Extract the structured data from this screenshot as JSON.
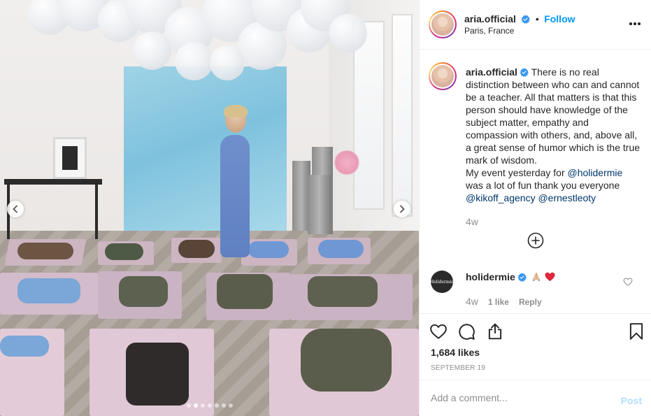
{
  "post": {
    "username": "aria.official",
    "follow_label": "Follow",
    "separator": "•",
    "location": "Paris, France",
    "image_alt": "Yoga class photo",
    "carousel": {
      "slides": 7,
      "active_index": 1
    }
  },
  "caption": {
    "username": "aria.official",
    "text_1": "There is no real distinction between who can and cannot be a teacher. All that matters is that this person should have knowledge of the subject matter, empathy and compassion with others, and, above all, a great sense of humor which is the true mark of wisdom.",
    "text_2": "My event yesterday for",
    "mention_1": "@holidermie",
    "text_3": "was a lot of fun thank you everyone",
    "mention_2": "@kikoff_agency",
    "mention_3": "@ernestleoty",
    "time": "4w"
  },
  "comment": {
    "avatar_text": "Holidermie",
    "username": "holidermie",
    "time": "4w",
    "likes": "1 like",
    "reply_label": "Reply"
  },
  "stats": {
    "likes": "1,684 likes",
    "date": "September 19"
  },
  "add_comment": {
    "placeholder": "Add a comment...",
    "post_label": "Post"
  },
  "colors": {
    "link": "#0095f6",
    "mention": "#00376b",
    "muted": "#8e8e8e",
    "post_disabled": "#b2dffc",
    "heart_red": "#ed4956"
  },
  "icons": [
    "verified-badge-icon",
    "more-options-icon",
    "chevron-left-icon",
    "chevron-right-icon",
    "plus-circle-icon",
    "heart-icon",
    "comment-icon",
    "share-icon",
    "bookmark-icon",
    "pray-emoji-icon",
    "red-heart-emoji-icon"
  ]
}
